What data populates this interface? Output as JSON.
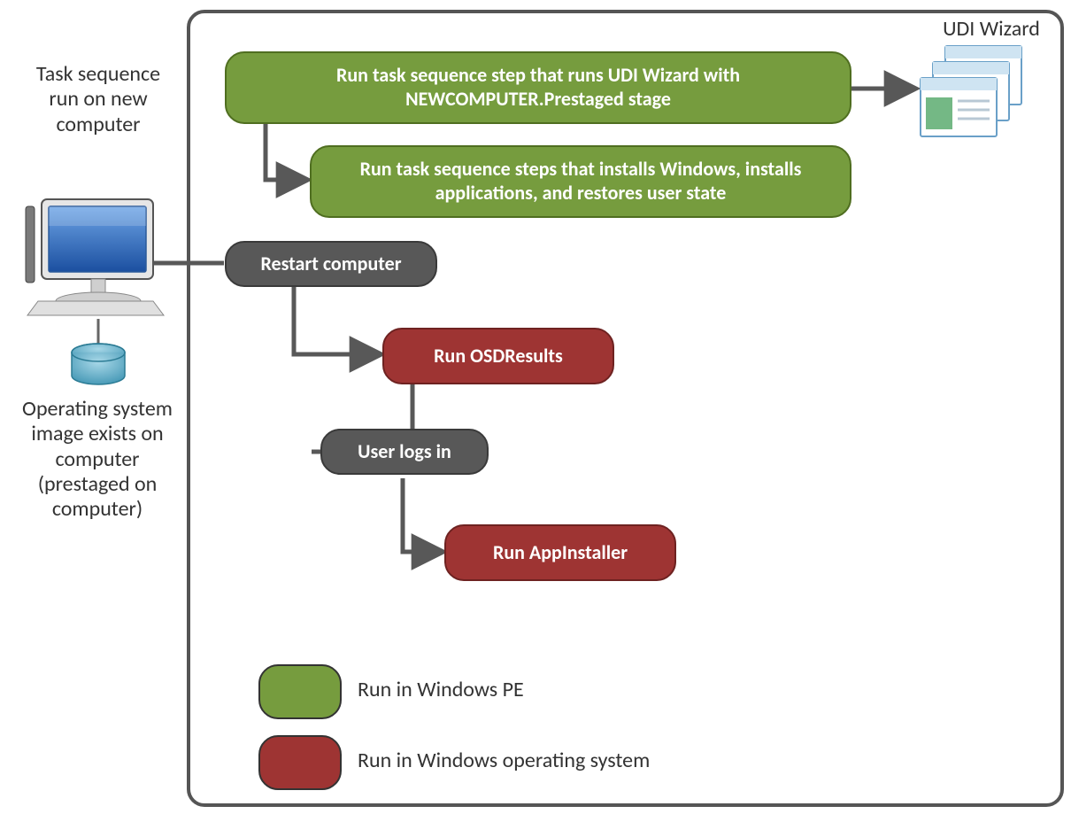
{
  "sidebar": {
    "label_top": "Task sequence run on new computer",
    "label_bottom": "Operating system image exists on computer (prestaged on computer)"
  },
  "header": {
    "udi_label": "UDI Wizard"
  },
  "nodes": {
    "step1": "Run task sequence step  that runs UDI Wizard with NEWCOMPUTER.Prestaged  stage",
    "step2": "Run task sequence steps that installs Windows, installs applications, and restores user state",
    "step3": "Restart computer",
    "step4": "Run OSDResults",
    "step5": "User logs in",
    "step6": "Run AppInstaller"
  },
  "legend": {
    "pe": "Run in Windows  PE",
    "os": "Run in Windows operating system"
  },
  "colors": {
    "green": "#769C3E",
    "green_border": "#4F6E20",
    "gray": "#585858",
    "red": "#9E3433",
    "red_border": "#6E2221",
    "frame": "#555"
  }
}
